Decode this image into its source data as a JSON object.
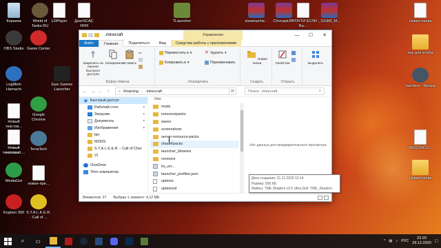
{
  "desktop": {
    "left_icons": [
      {
        "label": "Корзина",
        "kind": "bin"
      },
      {
        "label": "World of Tanks RU",
        "kind": "round",
        "color": "#6a5a3a"
      },
      {
        "label": "LDPlayer",
        "kind": "file"
      },
      {
        "label": "ДzатЅСАС ЯЯЯ",
        "kind": "file"
      },
      {
        "label": "OBS Studio",
        "kind": "round",
        "color": "#3a3a3a"
      },
      {
        "label": "Game Center",
        "kind": "round",
        "color": "#d02a2a"
      },
      {
        "label": "LogMeIn Hamachi",
        "kind": "round",
        "color": "#2e6fc0"
      },
      {
        "label": "Epic Games Launcher",
        "kind": "epic",
        "text": "EPIC GAMES"
      },
      {
        "label": "Новый текстов...",
        "kind": "file"
      },
      {
        "label": "Google Chrome",
        "kind": "round",
        "color": "#2f9e44"
      },
      {
        "label": "Новый текстов...",
        "kind": "file"
      },
      {
        "label": "TerraTech",
        "kind": "round",
        "color": "#4a7a9a"
      },
      {
        "label": "Новый текстовый ...",
        "kind": "file"
      },
      {
        "label": "MediaGet",
        "kind": "round",
        "color": "#2d9c4a"
      },
      {
        "label": "новое-пре...",
        "kind": "file"
      },
      {
        "label": "Krypton 300",
        "kind": "round",
        "color": "#c82020"
      },
      {
        "label": "S.T.A.L.K.E.R. - Call of ...",
        "kind": "round",
        "color": "#e0c020"
      }
    ],
    "top_icons": [
      {
        "label": "TLauncher",
        "kind": "tl"
      },
      {
        "label": "steamachie...",
        "kind": "rar"
      },
      {
        "label": "Chocapic1...",
        "kind": "rar"
      },
      {
        "label": "ПРОЧТИ ЕСЛИ Вы...",
        "kind": "file"
      },
      {
        "label": "_ISGMI_M...",
        "kind": "rar"
      }
    ],
    "right_icons": [
      {
        "label": "Новая папка",
        "kind": "file"
      },
      {
        "label": "пак для ютуба",
        "kind": "folder"
      },
      {
        "label": "hammer - Ярлык",
        "kind": "round",
        "color": "#445566"
      },
      {
        "label": "0RXCh0CO...",
        "kind": "file"
      },
      {
        "label": "Новая папка",
        "kind": "folder"
      }
    ]
  },
  "window": {
    "title": ".minecraft",
    "context_tab": "Управление",
    "controls": {
      "minimize": "—",
      "maximize": "☐",
      "close": "✕"
    },
    "tabs": [
      "Файл",
      "Главная",
      "Поделиться",
      "Вид",
      "Средства работы с приложениями"
    ],
    "ribbon": {
      "pin_label": "Закрепить на панели быстрого доступа",
      "copy_label": "Копировать",
      "paste_label": "Вставить",
      "clipboard_group": "Буфер обмена",
      "move_label": "Переместить в",
      "copy_to_label": "Копировать в",
      "delete_label": "Удалить",
      "rename_label": "Переименовать",
      "organize_group": "Упорядочить",
      "new_folder_label": "Новая папка",
      "create_group": "Создать",
      "properties_label": "Свойства",
      "open_group": "Открыть",
      "select_label": "Выделить"
    },
    "address": {
      "path": [
        "Roaming",
        ".minecraft"
      ],
      "search_placeholder": "Поиск: .minecraft"
    },
    "nav_pane": [
      {
        "label": "Быстрый доступ",
        "icon": "star",
        "selected": true,
        "pinned": false
      },
      {
        "label": "Рабочий стол",
        "icon": "desk",
        "selected": false,
        "pinned": true
      },
      {
        "label": "Загрузки",
        "icon": "down",
        "selected": false,
        "pinned": true
      },
      {
        "label": "Документы",
        "icon": "doc",
        "selected": false,
        "pinned": true
      },
      {
        "label": "Изображения",
        "icon": "img",
        "selected": false,
        "pinned": true
      },
      {
        "label": "bin",
        "icon": "fold",
        "selected": false,
        "pinned": false
      },
      {
        "label": "MODS",
        "icon": "fold",
        "selected": false,
        "pinned": false
      },
      {
        "label": "S.T.A.L.K.E.R. - Call of Cher",
        "icon": "fold",
        "selected": false,
        "pinned": false
      },
      {
        "label": "VI",
        "icon": "fold",
        "selected": false,
        "pinned": false
      },
      {
        "label": "OneDrive",
        "icon": "cloud",
        "selected": false,
        "pinned": false
      },
      {
        "label": "Этот компьютер",
        "icon": "pc",
        "selected": false,
        "pinned": false
      }
    ],
    "column_name": "Имя",
    "files": [
      {
        "name": "mods",
        "type": "folder"
      },
      {
        "name": "resourcepacks",
        "type": "folder"
      },
      {
        "name": "saves",
        "type": "folder"
      },
      {
        "name": "screenshots",
        "type": "folder"
      },
      {
        "name": "server-resource-packs",
        "type": "folder"
      },
      {
        "name": "shaderpacks",
        "type": "folder",
        "hover": true
      },
      {
        "name": "launcher_libraries",
        "type": "folder"
      },
      {
        "name": "versions",
        "type": "folder"
      },
      {
        "name": "hs_err...",
        "type": "file"
      },
      {
        "name": "launcher_profiles.json",
        "type": "file"
      },
      {
        "name": "options",
        "type": "file"
      },
      {
        "name": "optionsof",
        "type": "file"
      },
      {
        "name": "optionsshaders",
        "type": "file"
      }
    ],
    "preview_text": "Нет данных для предварительного просмотра.",
    "tooltip": {
      "date": "Дата создания: 21.12.2020 12:14",
      "size": "Размер: 505 КБ",
      "files": "Файлы: TME Shaders v2.5 Ultra DoF, TME_Shaders"
    },
    "status": {
      "count": "Элементов: 27",
      "selection": "Выбран 1 элемент: 4,12 МБ"
    }
  },
  "taskbar": {
    "start_icon": "windows-icon",
    "lang": "РУС",
    "time": "22:20",
    "date": "29.12.2020"
  },
  "colors": {
    "accent": "#1979ca",
    "selection": "#cce8ff",
    "hover": "#e5f3ff",
    "context_tab": "#f6e7a8"
  }
}
